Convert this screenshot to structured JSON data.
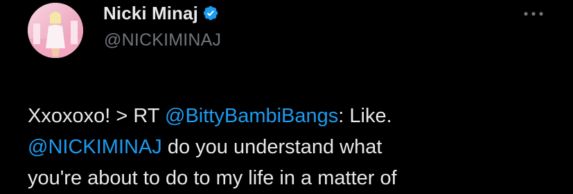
{
  "header": {
    "display_name": "Nicki Minaj",
    "handle": "@NICKIMINAJ",
    "verified": true,
    "verified_icon": "verified-badge-icon",
    "more_icon": "more-options-icon"
  },
  "tweet": {
    "line1_prefix": "Xxoxoxo! > RT ",
    "line1_mention": "@BittyBambiBangs",
    "line1_suffix": ": Like.",
    "line2_mention": "@NICKIMINAJ",
    "line2_suffix": " do you understand what",
    "line3": "you're about to do to my life in a matter of"
  },
  "colors": {
    "background": "#000000",
    "text": "#e7e9ea",
    "secondary": "#71767b",
    "accent": "#1d9bf0"
  }
}
